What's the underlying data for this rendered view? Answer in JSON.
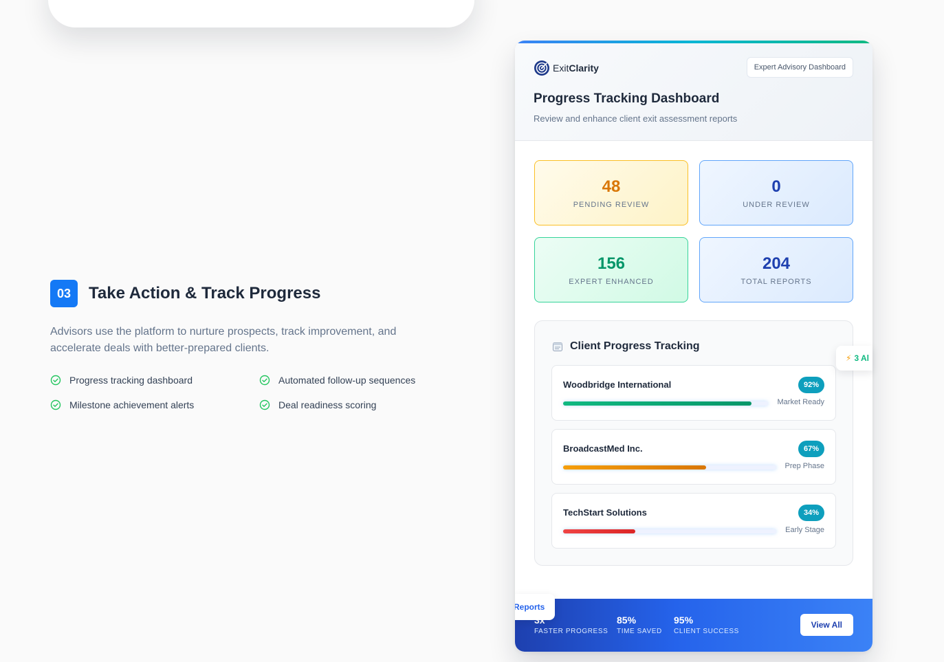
{
  "step": {
    "number": "03",
    "title": "Take Action & Track Progress",
    "description": "Advisors use the platform to nurture prospects, track improvement, and accelerate deals with better-prepared clients.",
    "features": [
      "Progress tracking dashboard",
      "Automated follow-up sequences",
      "Milestone achievement alerts",
      "Deal readiness scoring"
    ]
  },
  "card": {
    "brand": {
      "prefix": "Exit",
      "suffix": "Clarity"
    },
    "badge": "Expert Advisory Dashboard",
    "title": "Progress Tracking Dashboard",
    "subtitle": "Review and enhance client exit assessment reports",
    "stats": [
      {
        "value": "48",
        "label": "PENDING REVIEW"
      },
      {
        "value": "0",
        "label": "UNDER REVIEW"
      },
      {
        "value": "156",
        "label": "EXPERT ENHANCED"
      },
      {
        "value": "204",
        "label": "TOTAL REPORTS"
      }
    ],
    "tracking": {
      "title": "Client Progress Tracking",
      "clients": [
        {
          "name": "Woodbridge International",
          "percent": "92%",
          "progress": 0.92,
          "stage": "Market Ready"
        },
        {
          "name": "BroadcastMed Inc.",
          "percent": "67%",
          "progress": 0.67,
          "stage": "Prep Phase"
        },
        {
          "name": "TechStart Solutions",
          "percent": "34%",
          "progress": 0.34,
          "stage": "Early Stage"
        }
      ]
    },
    "alert_chip": "3 Al",
    "reports_chip": "Reports",
    "footer": {
      "stats": [
        {
          "value": "3x",
          "label": "FASTER PROGRESS"
        },
        {
          "value": "85%",
          "label": "TIME SAVED"
        },
        {
          "value": "95%",
          "label": "CLIENT SUCCESS"
        }
      ],
      "button": "View All"
    }
  },
  "colors": {
    "accent": "#1479f5",
    "progress_high": "#10b981",
    "progress_mid": "#f59e0b",
    "progress_low": "#ef4444"
  }
}
